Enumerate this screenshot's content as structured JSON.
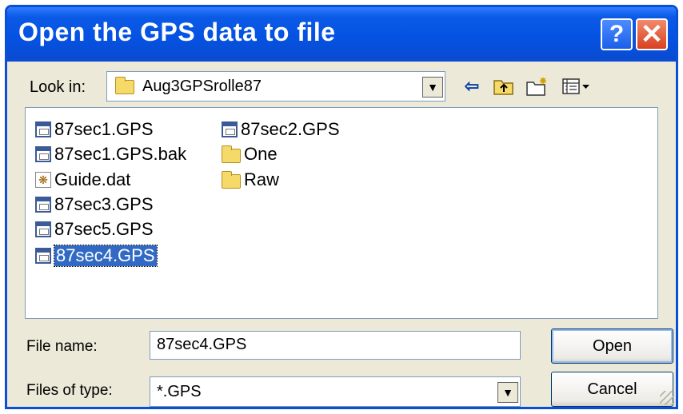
{
  "window": {
    "title": "Open the GPS data to file",
    "help_label": "?",
    "close_label": "✕"
  },
  "lookin": {
    "label": "Look in:",
    "value": "Aug3GPSrolle87",
    "icon": "folder-icon"
  },
  "toolbar": {
    "back_icon": "⇦",
    "up_icon": "⤴",
    "new_folder_icon": "✱",
    "view_icon": "▦▾"
  },
  "files": [
    {
      "name": "87sec1.GPS",
      "icon": "gps-file-icon",
      "selected": false
    },
    {
      "name": "87sec1.GPS.bak",
      "icon": "gps-file-icon",
      "selected": false
    },
    {
      "name": "Guide.dat",
      "icon": "dat-file-icon",
      "selected": false
    },
    {
      "name": "87sec3.GPS",
      "icon": "gps-file-icon",
      "selected": false
    },
    {
      "name": "87sec5.GPS",
      "icon": "gps-file-icon",
      "selected": false
    },
    {
      "name": "87sec4.GPS",
      "icon": "gps-file-icon",
      "selected": true
    },
    {
      "name": "87sec2.GPS",
      "icon": "gps-file-icon",
      "selected": false
    },
    {
      "name": "One",
      "icon": "folder-icon",
      "selected": false
    },
    {
      "name": "Raw",
      "icon": "folder-icon",
      "selected": false
    }
  ],
  "filename": {
    "label": "File name:",
    "value": "87sec4.GPS"
  },
  "filetype": {
    "label": "Files of type:",
    "value": "*.GPS"
  },
  "buttons": {
    "open": "Open",
    "cancel": "Cancel"
  }
}
